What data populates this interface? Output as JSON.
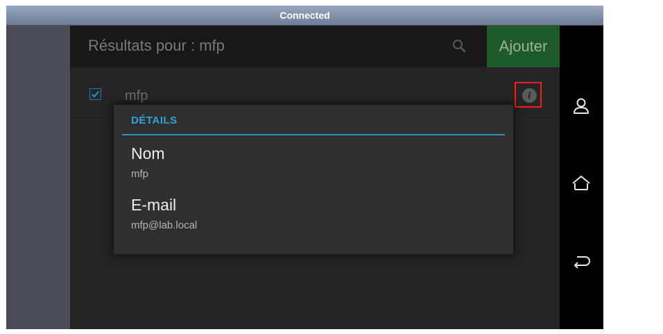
{
  "status_bar": {
    "title": "Connected"
  },
  "action_bar": {
    "search_title": "Résultats pour : mfp",
    "search_icon": "search-icon",
    "add_label": "Ajouter"
  },
  "results": [
    {
      "name": "mfp",
      "checked": true
    }
  ],
  "details_dialog": {
    "title": "DÉTAILS",
    "fields": [
      {
        "label": "Nom",
        "value": "mfp"
      },
      {
        "label": "E-mail",
        "value": "mfp@lab.local"
      }
    ]
  },
  "nav_icons": [
    "user-icon",
    "home-icon",
    "back-icon"
  ],
  "colors": {
    "accent_blue": "#33a3d9",
    "add_button": "#1f5a2a",
    "highlight_box": "#ff1a1a",
    "status_bar": "#8b97ae"
  }
}
